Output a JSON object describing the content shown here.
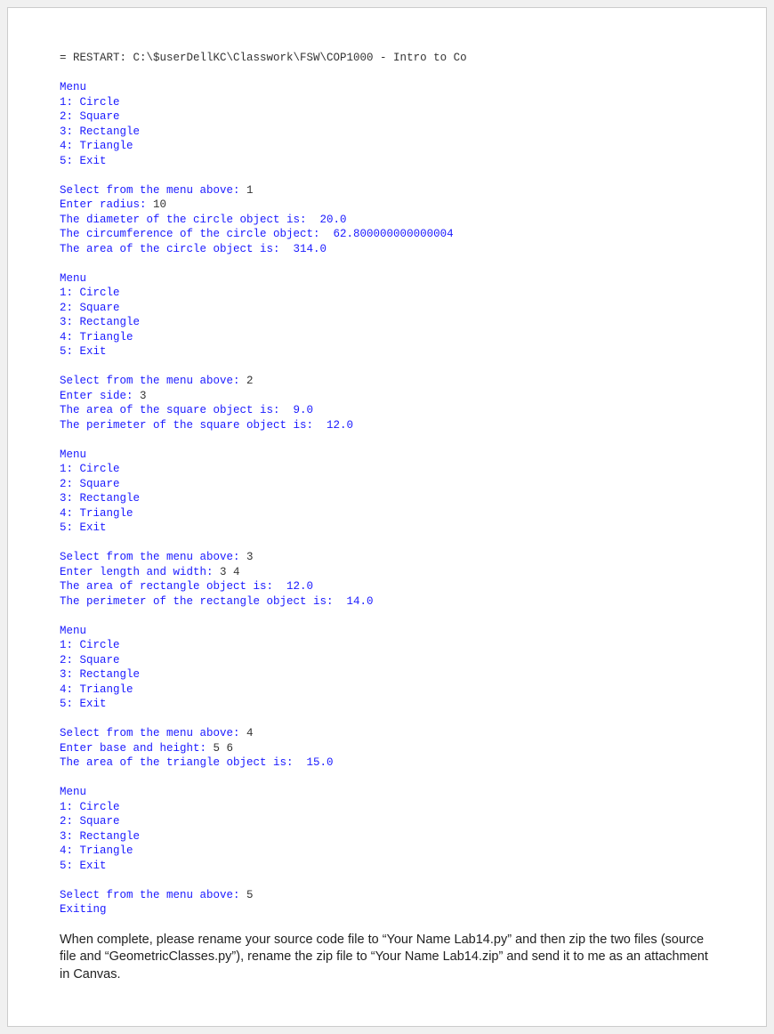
{
  "console": {
    "restart_line": "= RESTART: C:\\$userDellKC\\Classwork\\FSW\\COP1000 - Intro to Co",
    "menu_header": "Menu",
    "menu_items": [
      "1: Circle",
      "2: Square",
      "3: Rectangle",
      "4: Triangle",
      "5: Exit"
    ],
    "prompt_select": "Select from the menu above: ",
    "runs": [
      {
        "select_input": "1",
        "extra_prompt": "Enter radius: ",
        "extra_input": "10",
        "outputs": [
          "The diameter of the circle object is:  20.0",
          "The circumference of the circle object:  62.800000000000004",
          "The area of the circle object is:  314.0"
        ]
      },
      {
        "select_input": "2",
        "extra_prompt": "Enter side: ",
        "extra_input": "3",
        "outputs": [
          "The area of the square object is:  9.0",
          "The perimeter of the square object is:  12.0"
        ]
      },
      {
        "select_input": "3",
        "extra_prompt": "Enter length and width: ",
        "extra_input": "3 4",
        "outputs": [
          "The area of rectangle object is:  12.0",
          "The perimeter of the rectangle object is:  14.0"
        ]
      },
      {
        "select_input": "4",
        "extra_prompt": "Enter base and height: ",
        "extra_input": "5 6",
        "outputs": [
          "The area of the triangle object is:  15.0"
        ]
      },
      {
        "select_input": "5",
        "extra_prompt": "",
        "extra_input": "",
        "outputs": [
          "Exiting"
        ]
      }
    ]
  },
  "instructions_text": "When complete, please rename your source code file to “Your Name Lab14.py” and then zip the two files (source file and “GeometricClasses.py”), rename the zip file to “Your Name Lab14.zip” and send it to me as an attachment in Canvas."
}
